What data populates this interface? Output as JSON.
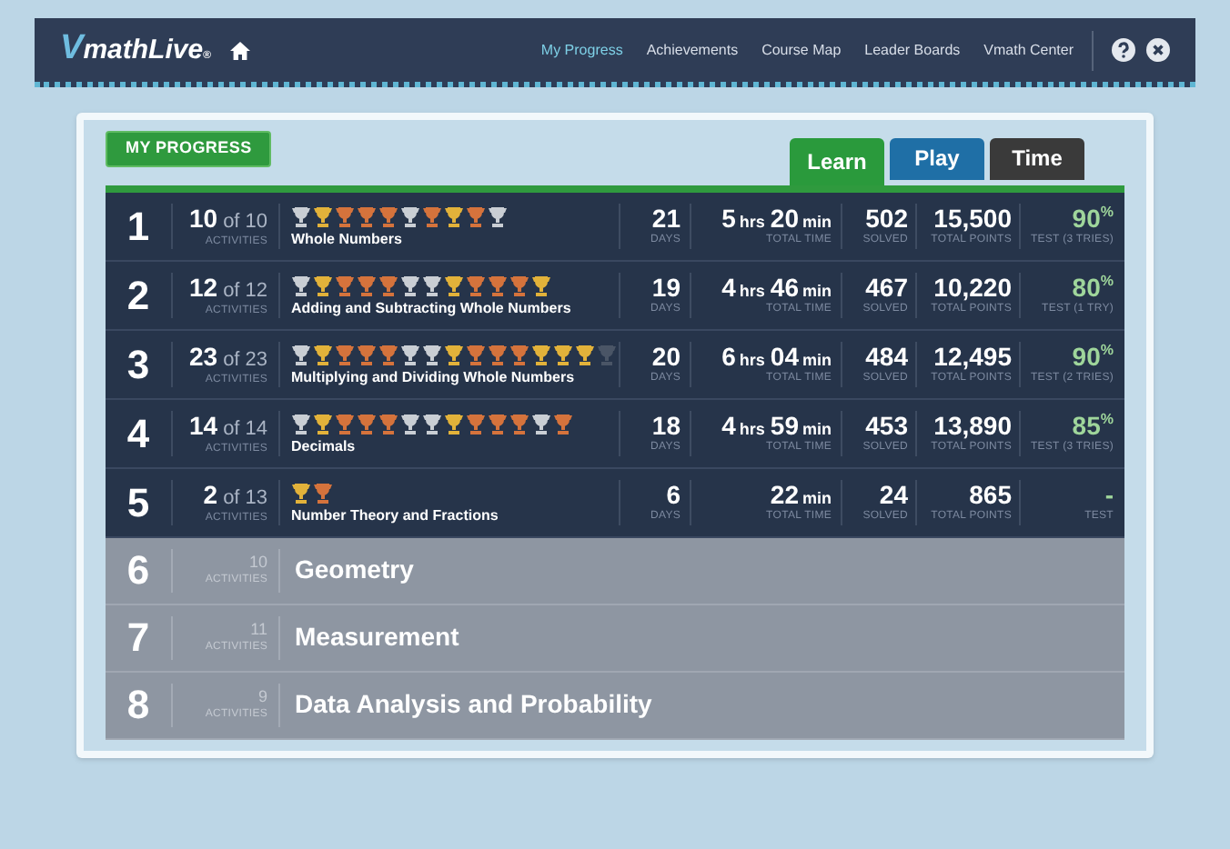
{
  "header": {
    "logo": {
      "v": "V",
      "rest": "mathLive",
      "mark": "®"
    },
    "nav": [
      {
        "label": "My Progress",
        "selected": true
      },
      {
        "label": "Achievements",
        "selected": false
      },
      {
        "label": "Course Map",
        "selected": false
      },
      {
        "label": "Leader Boards",
        "selected": false
      },
      {
        "label": "Vmath Center",
        "selected": false
      }
    ]
  },
  "section_title": "MY PROGRESS",
  "tabs": [
    {
      "label": "Learn",
      "selected": true,
      "color": "#2a9a3c"
    },
    {
      "label": "Play",
      "selected": false,
      "color": "#1f6fa6"
    },
    {
      "label": "Time",
      "selected": false,
      "color": "#3a3a3a"
    }
  ],
  "units": [
    {
      "kind": "started",
      "number": "1",
      "done": "10",
      "of": "of",
      "total": "10",
      "activities_label": "ACTIVITIES",
      "name": "Whole Numbers",
      "trophies": [
        {
          "color": "#c9ced4"
        },
        {
          "color": "#e2b23a"
        },
        {
          "color": "#d5733c"
        },
        {
          "color": "#d5733c"
        },
        {
          "color": "#d5733c"
        },
        {
          "color": "#c9ced4"
        },
        {
          "color": "#d5733c"
        },
        {
          "color": "#e2b23a"
        },
        {
          "color": "#d5733c"
        },
        {
          "color": "#c9ced4"
        }
      ],
      "days": "21",
      "days_label": "DAYS",
      "time": [
        {
          "value": "5",
          "unit": "hrs"
        },
        {
          "value": "20",
          "unit": "min"
        }
      ],
      "time_label": "TOTAL TIME",
      "solved": "502",
      "solved_label": "SOLVED",
      "points": "15,500",
      "points_label": "TOTAL POINTS",
      "test": "90",
      "test_unit": "%",
      "test_label": "TEST (3 TRIES)"
    },
    {
      "kind": "started",
      "number": "2",
      "done": "12",
      "of": "of",
      "total": "12",
      "activities_label": "ACTIVITIES",
      "name": "Adding and Subtracting Whole Numbers",
      "trophies": [
        {
          "color": "#c9ced4"
        },
        {
          "color": "#e2b23a"
        },
        {
          "color": "#d5733c"
        },
        {
          "color": "#d5733c"
        },
        {
          "color": "#d5733c"
        },
        {
          "color": "#c9ced4"
        },
        {
          "color": "#c9ced4"
        },
        {
          "color": "#e2b23a"
        },
        {
          "color": "#d5733c"
        },
        {
          "color": "#d5733c"
        },
        {
          "color": "#d5733c"
        },
        {
          "color": "#e2b23a"
        }
      ],
      "days": "19",
      "days_label": "DAYS",
      "time": [
        {
          "value": "4",
          "unit": "hrs"
        },
        {
          "value": "46",
          "unit": "min"
        }
      ],
      "time_label": "TOTAL TIME",
      "solved": "467",
      "solved_label": "SOLVED",
      "points": "10,220",
      "points_label": "TOTAL POINTS",
      "test": "80",
      "test_unit": "%",
      "test_label": "TEST (1 TRY)"
    },
    {
      "kind": "started",
      "number": "3",
      "done": "23",
      "of": "of",
      "total": "23",
      "activities_label": "ACTIVITIES",
      "name": "Multiplying and Dividing Whole Numbers",
      "trophies": [
        {
          "color": "#c9ced4"
        },
        {
          "color": "#e2b23a"
        },
        {
          "color": "#d5733c"
        },
        {
          "color": "#d5733c"
        },
        {
          "color": "#d5733c"
        },
        {
          "color": "#c9ced4"
        },
        {
          "color": "#c9ced4"
        },
        {
          "color": "#e2b23a"
        },
        {
          "color": "#d5733c"
        },
        {
          "color": "#d5733c"
        },
        {
          "color": "#d5733c"
        },
        {
          "color": "#e2b23a"
        },
        {
          "color": "#e2b23a"
        },
        {
          "color": "#e2b23a"
        },
        {
          "color": "#4a5566"
        }
      ],
      "days": "20",
      "days_label": "DAYS",
      "time": [
        {
          "value": "6",
          "unit": "hrs"
        },
        {
          "value": "04",
          "unit": "min"
        }
      ],
      "time_label": "TOTAL TIME",
      "solved": "484",
      "solved_label": "SOLVED",
      "points": "12,495",
      "points_label": "TOTAL POINTS",
      "test": "90",
      "test_unit": "%",
      "test_label": "TEST (2 TRIES)"
    },
    {
      "kind": "started",
      "number": "4",
      "done": "14",
      "of": "of",
      "total": "14",
      "activities_label": "ACTIVITIES",
      "name": "Decimals",
      "trophies": [
        {
          "color": "#c9ced4"
        },
        {
          "color": "#e2b23a"
        },
        {
          "color": "#d5733c"
        },
        {
          "color": "#d5733c"
        },
        {
          "color": "#d5733c"
        },
        {
          "color": "#c9ced4"
        },
        {
          "color": "#c9ced4"
        },
        {
          "color": "#e2b23a"
        },
        {
          "color": "#d5733c"
        },
        {
          "color": "#d5733c"
        },
        {
          "color": "#d5733c"
        },
        {
          "color": "#c9ced4"
        },
        {
          "color": "#d5733c"
        }
      ],
      "days": "18",
      "days_label": "DAYS",
      "time": [
        {
          "value": "4",
          "unit": "hrs"
        },
        {
          "value": "59",
          "unit": "min"
        }
      ],
      "time_label": "TOTAL TIME",
      "solved": "453",
      "solved_label": "SOLVED",
      "points": "13,890",
      "points_label": "TOTAL POINTS",
      "test": "85",
      "test_unit": "%",
      "test_label": "TEST (3 TRIES)"
    },
    {
      "kind": "started",
      "number": "5",
      "done": "2",
      "of": "of",
      "total": "13",
      "activities_label": "ACTIVITIES",
      "name": "Number Theory and Fractions",
      "trophies": [
        {
          "color": "#e2b23a"
        },
        {
          "color": "#d5733c"
        }
      ],
      "days": "6",
      "days_label": "DAYS",
      "time": [
        {
          "value": "22",
          "unit": "min"
        }
      ],
      "time_label": "TOTAL TIME",
      "solved": "24",
      "solved_label": "SOLVED",
      "points": "865",
      "points_label": "TOTAL POINTS",
      "test": "-",
      "test_label": "TEST"
    },
    {
      "kind": "locked",
      "number": "6",
      "total": "10",
      "activities_label": "ACTIVITIES",
      "name": "Geometry"
    },
    {
      "kind": "locked",
      "number": "7",
      "total": "11",
      "activities_label": "ACTIVITIES",
      "name": "Measurement"
    },
    {
      "kind": "locked",
      "number": "8",
      "total": "9",
      "activities_label": "ACTIVITIES",
      "name": "Data Analysis and Probability"
    }
  ]
}
